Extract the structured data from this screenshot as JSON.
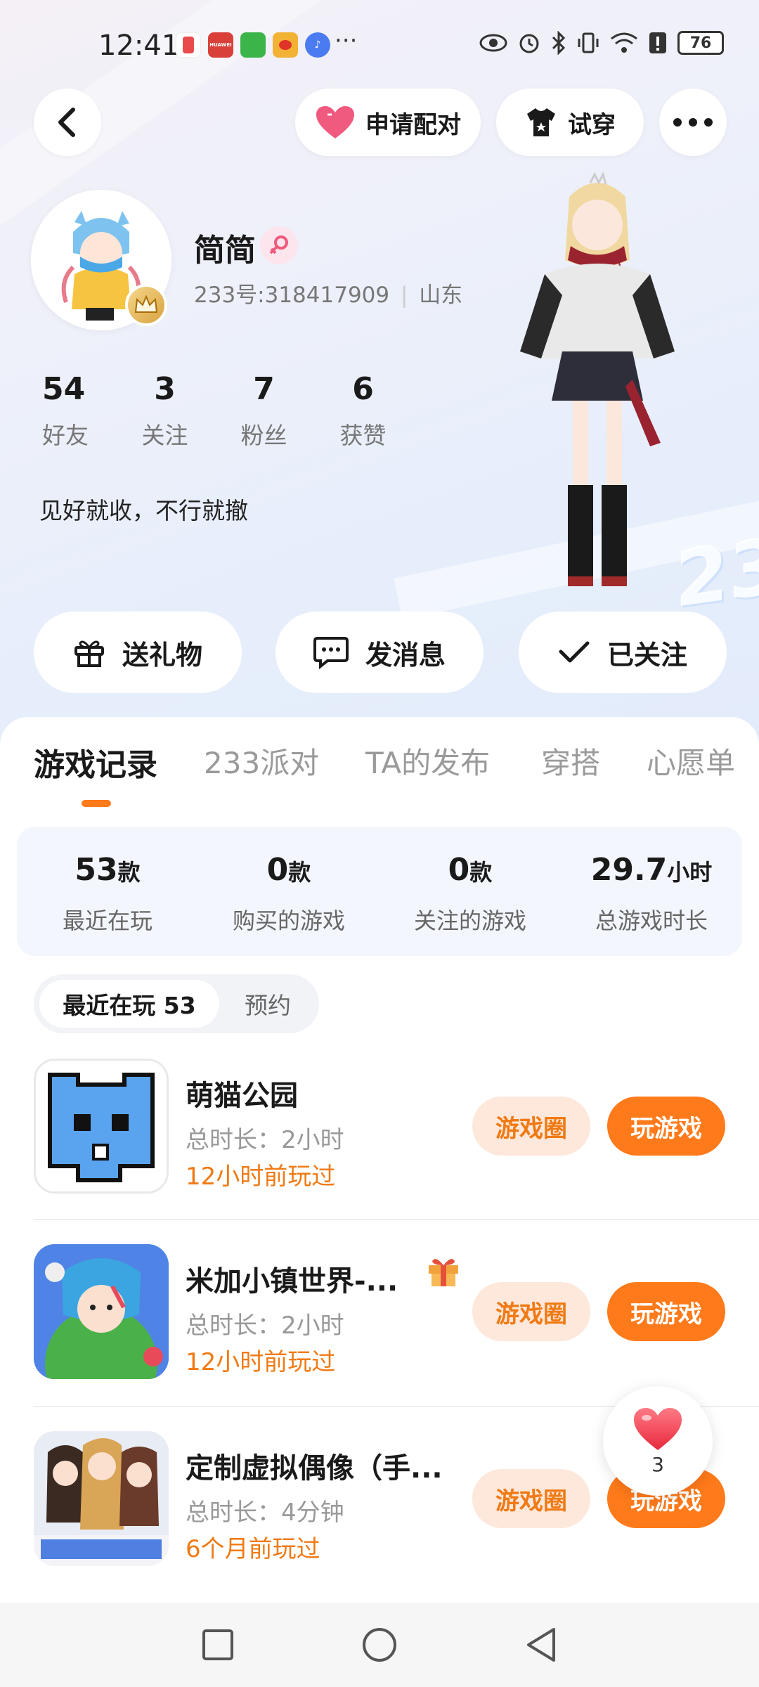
{
  "status_bar": {
    "time": "12:41",
    "more": "···",
    "battery": "76",
    "apps": [
      {
        "name": "notification-app-1-icon",
        "color": "#e94b4b"
      },
      {
        "name": "huawei-app-icon",
        "color": "#d9403a",
        "label": "HUAWEI"
      },
      {
        "name": "tapmall-app-icon",
        "color": "#3bb54a"
      },
      {
        "name": "weibo-app-icon",
        "color": "#f2b233"
      },
      {
        "name": "music-app-icon",
        "color": "#4a7bf0"
      }
    ]
  },
  "header": {
    "pair_label": "申请配对",
    "try_on_label": "试穿"
  },
  "profile": {
    "nickname": "简简",
    "user_id": "233号:318417909",
    "location": "山东",
    "bio": "见好就收，不行就撤",
    "stats": [
      {
        "value": "54",
        "label": "好友"
      },
      {
        "value": "3",
        "label": "关注"
      },
      {
        "value": "7",
        "label": "粉丝"
      },
      {
        "value": "6",
        "label": "获赞"
      }
    ]
  },
  "actions": {
    "gift": "送礼物",
    "message": "发消息",
    "follow": "已关注"
  },
  "tabs": [
    "游戏记录",
    "233派对",
    "TA的发布",
    "穿搭",
    "心愿单"
  ],
  "summary": [
    {
      "value": "53",
      "unit": "款",
      "label": "最近在玩"
    },
    {
      "value": "0",
      "unit": "款",
      "label": "购买的游戏"
    },
    {
      "value": "0",
      "unit": "款",
      "label": "关注的游戏"
    },
    {
      "value": "29.7",
      "unit": "小时",
      "label": "总游戏时长"
    }
  ],
  "subtabs": {
    "active": "最近在玩 53",
    "other": "预约"
  },
  "games": [
    {
      "title": "萌猫公园",
      "duration": "总时长：2小时",
      "last_played": "12小时前玩过",
      "circle_label": "游戏圈",
      "play_label": "玩游戏"
    },
    {
      "title": "米加小镇世界-...",
      "duration": "总时长：2小时",
      "last_played": "12小时前玩过",
      "circle_label": "游戏圈",
      "play_label": "玩游戏"
    },
    {
      "title": "定制虚拟偶像（手...",
      "duration": "总时长：4分钟",
      "last_played": "6个月前玩过",
      "circle_label": "游戏圈",
      "play_label": "玩游戏"
    }
  ],
  "like_float": {
    "count": "3"
  },
  "colors": {
    "accent": "#ff7a1a",
    "accent_soft": "#fde8db",
    "accent_text": "#f07a14",
    "pink": "#f05a7e"
  }
}
